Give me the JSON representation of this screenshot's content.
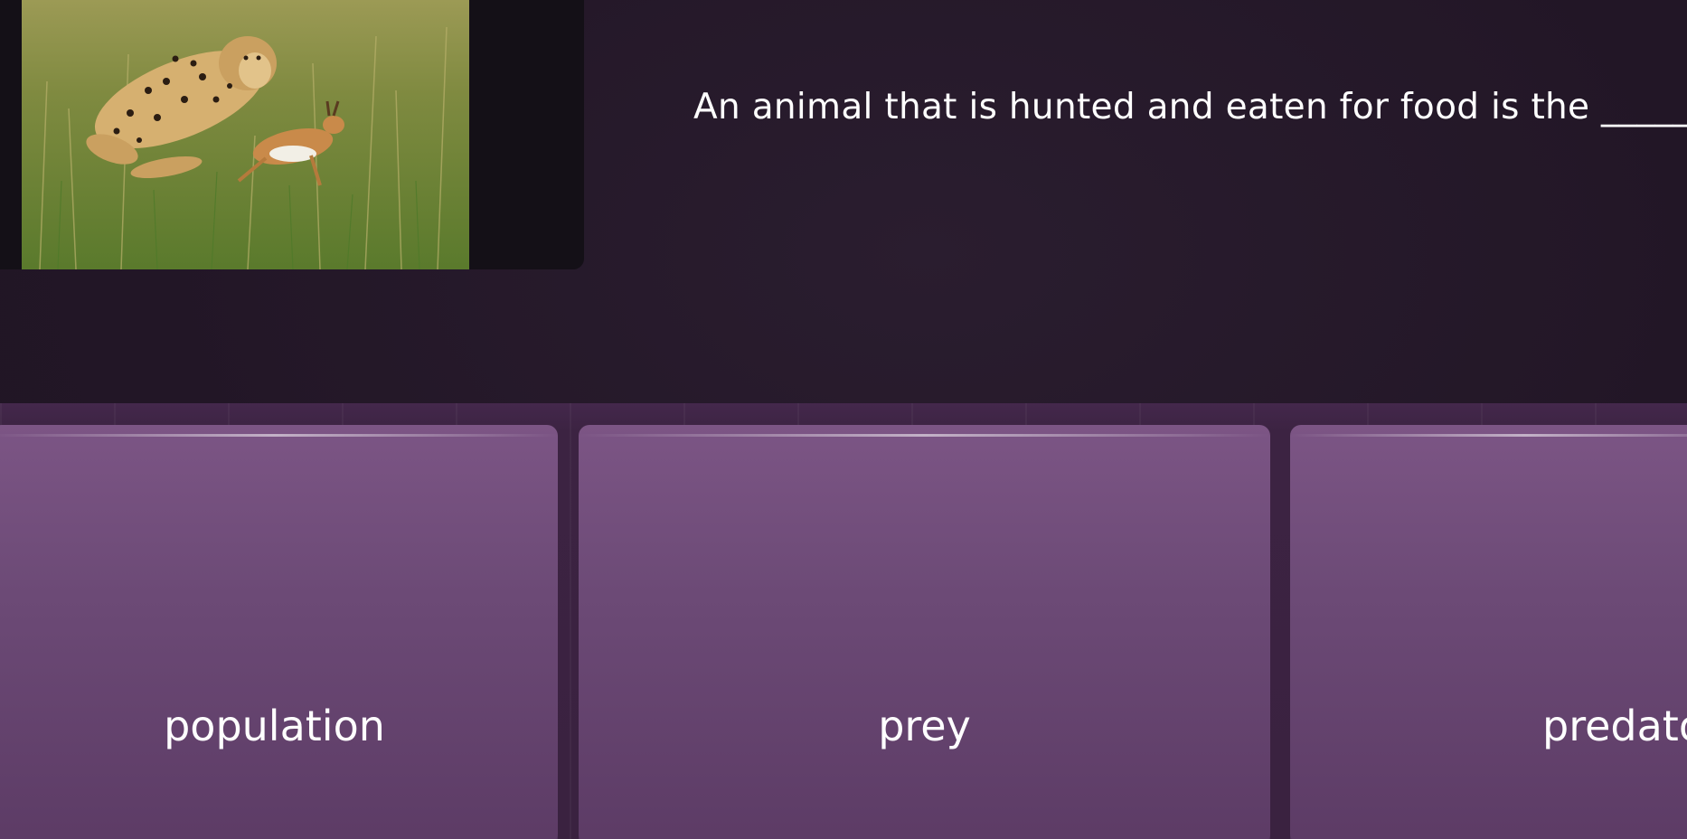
{
  "question": {
    "text": "An animal that is hunted and eaten for food is the _______",
    "image_icon": "cheetah-chasing-gazelle-photo"
  },
  "options": [
    {
      "label": "population"
    },
    {
      "label": "prey"
    },
    {
      "label": "predator"
    }
  ],
  "colors": {
    "background": "#231827",
    "media_panel": "#141017",
    "option_top": "#7c5585",
    "option_bottom": "#5c3b65",
    "text": "#ffffff"
  }
}
